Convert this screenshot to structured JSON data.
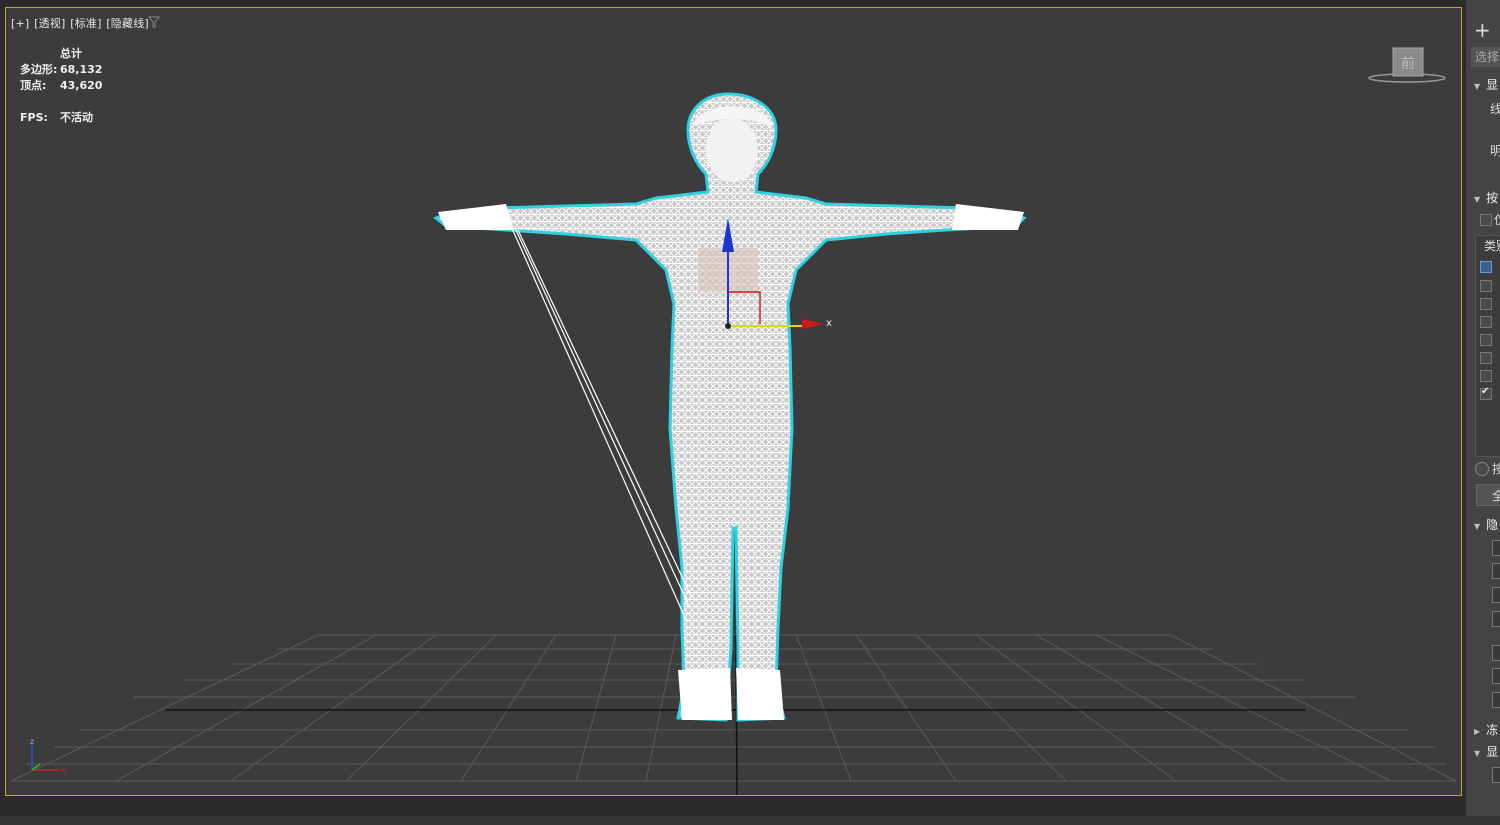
{
  "viewport": {
    "label_parts": [
      "[+]",
      "[透视]",
      "[标准]",
      "[隐藏线]"
    ],
    "stats": {
      "header": "总计",
      "polygons_label": "多边形:",
      "polygons_value": "68,132",
      "vertices_label": "顶点:",
      "vertices_value": "43,620",
      "fps_label": "FPS:",
      "fps_value": "不活动"
    },
    "viewcube_label": "前",
    "gizmo_x_label": "x",
    "axis_z_label": "z",
    "axis_x_label": "x"
  },
  "colors": {
    "viewport_bg": "#3c3c3c",
    "active_border": "#c2a53a",
    "selection_outline": "#2fd0e0",
    "wire": "#ffffff",
    "gizmo_x": "#d01818",
    "gizmo_y": "#d8d820",
    "gizmo_z": "#1838d0"
  },
  "command_panel": {
    "add_icon": "plus-icon",
    "select_placeholder": "选择",
    "rollouts": [
      {
        "label": "显",
        "expanded": true
      },
      {
        "label": "按",
        "expanded": true
      },
      {
        "label": "隐",
        "expanded": true
      },
      {
        "label": "冻",
        "expanded": false
      },
      {
        "label": "显",
        "expanded": true
      }
    ],
    "text_line": "线",
    "text_ming": "明",
    "text_fen": "仅",
    "list_header": "类别",
    "radio_label": "按",
    "button_label": "全"
  }
}
